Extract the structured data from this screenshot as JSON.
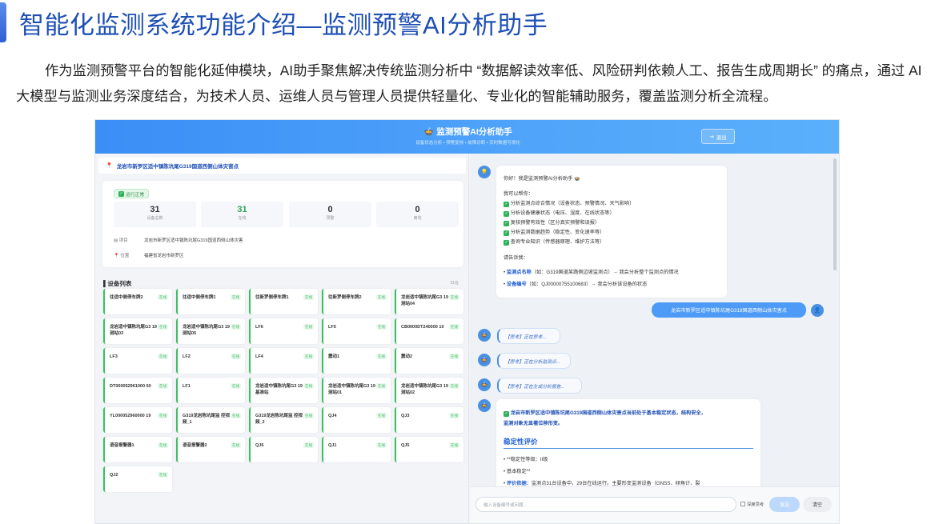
{
  "slide": {
    "title": "智能化监测系统功能介绍—监测预警AI分析助手",
    "paragraph": "作为监测预警平台的智能化延伸模块，AI助手聚焦解决传统监测分析中 “数据解读效率低、风险研判依赖人工、报告生成周期长” 的痛点，通过 AI 大模型与监测业务深度结合，为技术人员、运维人员与管理人员提供轻量化、专业化的智能辅助服务，覆盖监测分析全流程。"
  },
  "app": {
    "title": "🍲 监测预警AI分析助手",
    "subtitle": "设备状态分析 • 预警复核 • 故障诊断 • 实时数据可视化",
    "exit_label": "退出",
    "location": "龙岩市新罗区适中镇陈坑尾G319国道西侧山体灾害点",
    "status": "运行正常",
    "stats": [
      {
        "value": "31",
        "label": "设备总数"
      },
      {
        "value": "31",
        "label": "在线"
      },
      {
        "value": "0",
        "label": "预警"
      },
      {
        "value": "0",
        "label": "离线"
      }
    ],
    "project_label": "项目",
    "project_value": "龙岩市新罗区适中镇陈坑尾G319国道西侧山体灾害",
    "position_label": "位置",
    "position_value": "福建省龙岩市新罗区",
    "device_list_title": "设备列表",
    "device_count": "31台",
    "online_text": "在线",
    "devices": [
      "往适中侧停车牌2",
      "往适中侧停车牌1",
      "往新罗侧停车牌1",
      "往新罗侧停车牌2",
      "龙岩适中镇陈坑尾G3 19测站04",
      "龙岩适中镇陈坑尾G3 19测站03",
      "龙岩适中镇陈坑尾G3 19测站05",
      "LF6",
      "LF5",
      "CB0000DT240000 10",
      "LF3",
      "LF2",
      "LF4",
      "震动1",
      "震动2",
      "DT000052961000 60",
      "LF1",
      "龙岩适中镇陈坑尾G3 19基准站",
      "龙岩适中镇陈坑尾G3 19测站01",
      "龙岩适中镇陈坑尾G3 19测站02",
      "YL000052960000 19",
      "G319龙岩陈坑尾监 控视频_1",
      "G319龙岩陈坑尾监 控视频_2",
      "QJ4",
      "QJ3",
      "语音报警器1",
      "语音报警器2",
      "QJ6",
      "QJ1",
      "QJ5",
      "QJ2"
    ],
    "chat": {
      "greeting": "你好！我是监测预警AI分析助手 🍲",
      "can_help": "我可以帮你：",
      "abilities": [
        "分析监测点综合情况（设备状态、预警情况、天气影响）",
        "分析设备健康状态（电压、湿度、在线状态等）",
        "复核预警有效性（区分真实预警和误报）",
        "分析监测数据趋势（稳定性、变化速率等）",
        "查询专业知识（传感器原理、维护方法等）"
      ],
      "tell_me": "请告诉我：",
      "hint1_key": "监测点名称",
      "hint1_rest": "（如：G319国道某路侧边坡监测点）→ 我会分析整个监测点的情况",
      "hint2_key": "设备编号",
      "hint2_rest": "（如：QJ00000755100683）→ 我会分析该设备的状态",
      "user_message": "龙岩市新罗区适中镇陈坑尾G319国道西侧山体灾害点",
      "thinking": [
        "【思考】正在思考...",
        "【思考】正在分析监测点...",
        "【思考】正在生成分析报告..."
      ],
      "result_line1": "龙岩市新罗区适中镇陈坑尾G319国道西侧山体灾害点当前处于基本稳定状态，结构安全，",
      "result_line2": "监测对象无显著位移形变。",
      "eval_title": "稳定性评价",
      "eval_items": [
        "**稳定性等级：II级",
        "基本稳定**"
      ],
      "eval_basis_key": "评价依据：",
      "eval_basis_rest": "监测点31台设备中，29台在线运行。主要形变监测设备（GNSS、倾角计、裂",
      "input_placeholder": "输入设备编号或问题...",
      "deep_think": "深度思考",
      "send": "发送",
      "clear": "清空"
    }
  }
}
